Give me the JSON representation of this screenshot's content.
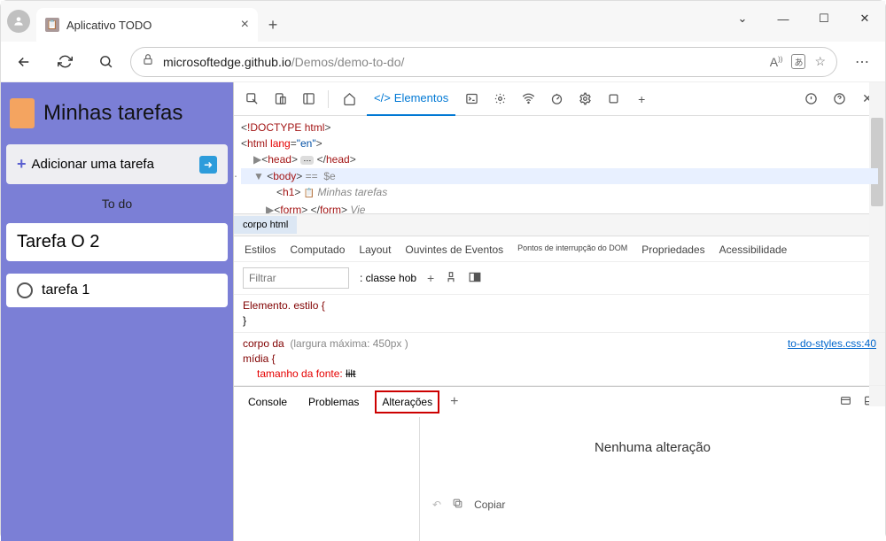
{
  "titlebar": {
    "tab_title": "Aplicativo TODO"
  },
  "toolbar": {
    "url_host": "microsoftedge.github.io",
    "url_path": "/Demos/demo-to-do/",
    "reader_label": "A))"
  },
  "app": {
    "title": "Minhas tarefas",
    "add_label": "Adicionar uma tarefa",
    "section_label": "To do",
    "tasks": [
      {
        "name": "Tarefa O 2",
        "show_circle": false
      },
      {
        "name": "tarefa 1",
        "show_circle": true
      }
    ]
  },
  "devtools": {
    "elements_tab": "Elementos",
    "dom": {
      "doctype": "!DOCTYPE html",
      "html_open": "html",
      "html_lang_attr": "lang",
      "html_lang_val": "\"en\"",
      "head": "head",
      "body": "body",
      "eq": "==",
      "dollar": "$e",
      "h1": "h1",
      "h1_text": "Minhas tarefas",
      "form": "form",
      "form_text": "Vie"
    },
    "crumb": "corpo html",
    "styles_tabs": {
      "estilos": "Estilos",
      "computado": "Computado",
      "layout": "Layout",
      "ouvintes": "Ouvintes de Eventos",
      "breakpoints": "Pontos de interrupção do DOM",
      "propriedades": "Propriedades",
      "acessibilidade": "Acessibilidade"
    },
    "filter": {
      "placeholder": "Filtrar",
      "hov": ": classe hob"
    },
    "rule1": {
      "selector": "Elemento. estilo {",
      "close": "}"
    },
    "rule2": {
      "selector": "corpo da",
      "media_label": "(largura máxima: 450px )",
      "media": "mídia {",
      "prop": "tamanho da fonte:",
      "val": "lilt",
      "link": "to-do-styles.css:40"
    },
    "drawer": {
      "console": "Console",
      "problems": "Problemas",
      "changes": "Alterações",
      "empty": "Nenhuma alteração",
      "copy": "Copiar"
    }
  }
}
